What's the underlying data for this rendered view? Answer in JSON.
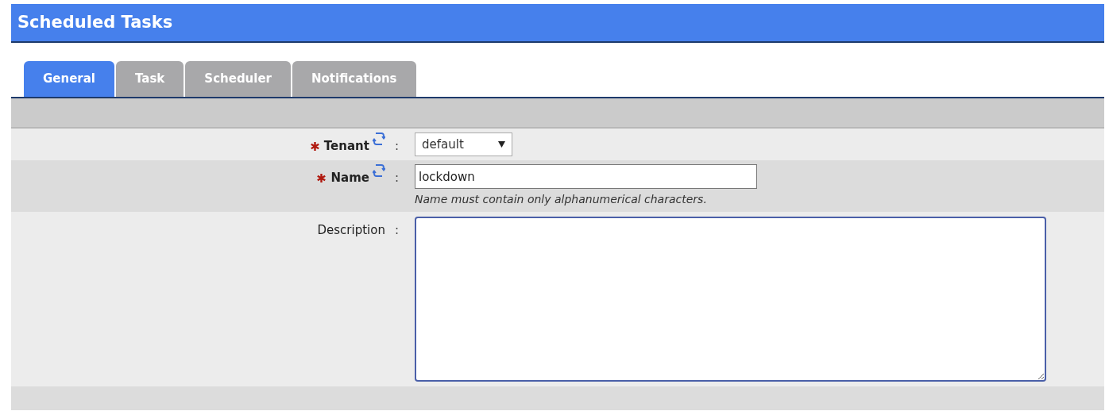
{
  "header": {
    "title": "Scheduled Tasks"
  },
  "tabs": [
    {
      "label": "General",
      "selected": true
    },
    {
      "label": "Task",
      "selected": false
    },
    {
      "label": "Scheduler",
      "selected": false
    },
    {
      "label": "Notifications",
      "selected": false
    }
  ],
  "fields": [
    {
      "kind": "select",
      "label": "Tenant",
      "required": true,
      "refreshable": true,
      "separator": ":",
      "value": "default"
    },
    {
      "kind": "text",
      "label": "Name",
      "required": true,
      "refreshable": true,
      "separator": ":",
      "value": "lockdown",
      "hint": "Name must contain only alphanumerical characters."
    },
    {
      "kind": "textarea",
      "label": "Description",
      "required": false,
      "refreshable": false,
      "separator": ":"
    }
  ]
}
